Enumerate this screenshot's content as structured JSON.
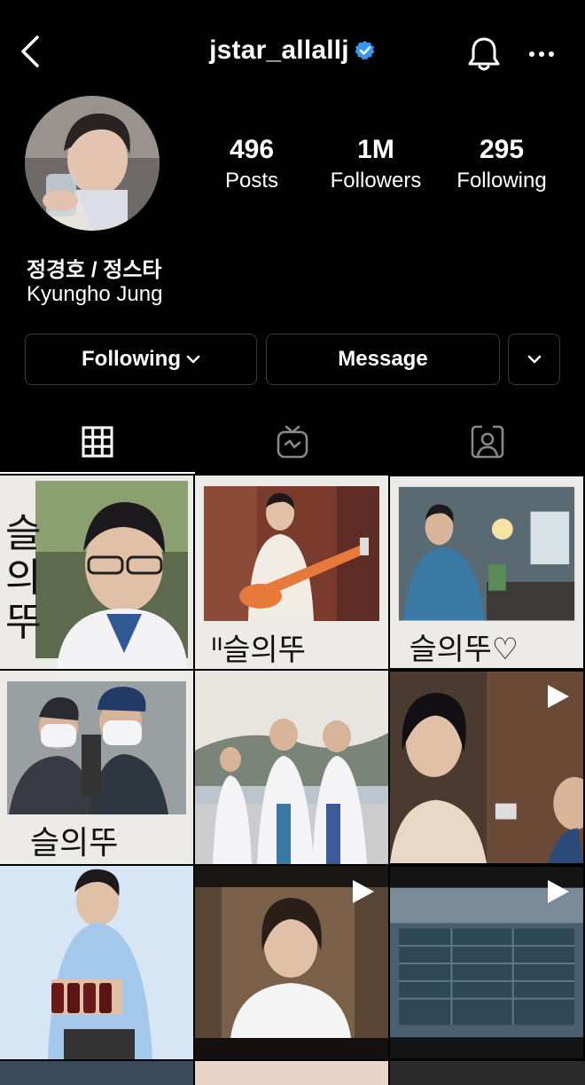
{
  "header": {
    "username": "jstar_allallj",
    "back_icon": "back-chevron-icon",
    "verified_icon": "verified-badge-icon",
    "bell_icon": "bell-icon",
    "more_icon": "more-horizontal-icon",
    "verified_color": "#3897f0"
  },
  "profile": {
    "name": "정경호 / 정스타",
    "subname": "Kyungho Jung",
    "stats": {
      "posts_count": "496",
      "posts_label": "Posts",
      "followers_count": "1M",
      "followers_label": "Followers",
      "following_count": "295",
      "following_label": "Following"
    }
  },
  "actions": {
    "following_label": "Following",
    "message_label": "Message"
  },
  "tabs": [
    {
      "icon": "grid-icon",
      "active": true
    },
    {
      "icon": "igtv-icon",
      "active": false
    },
    {
      "icon": "tagged-icon",
      "active": false
    }
  ],
  "posts": [
    {
      "type": "photo",
      "caption": "슬의뚜"
    },
    {
      "type": "photo",
      "caption": "슬의뚜"
    },
    {
      "type": "photo",
      "caption": "슬의뚜"
    },
    {
      "type": "photo",
      "caption": "슬의뚜"
    },
    {
      "type": "photo"
    },
    {
      "type": "video"
    },
    {
      "type": "photo"
    },
    {
      "type": "video"
    },
    {
      "type": "video"
    }
  ]
}
